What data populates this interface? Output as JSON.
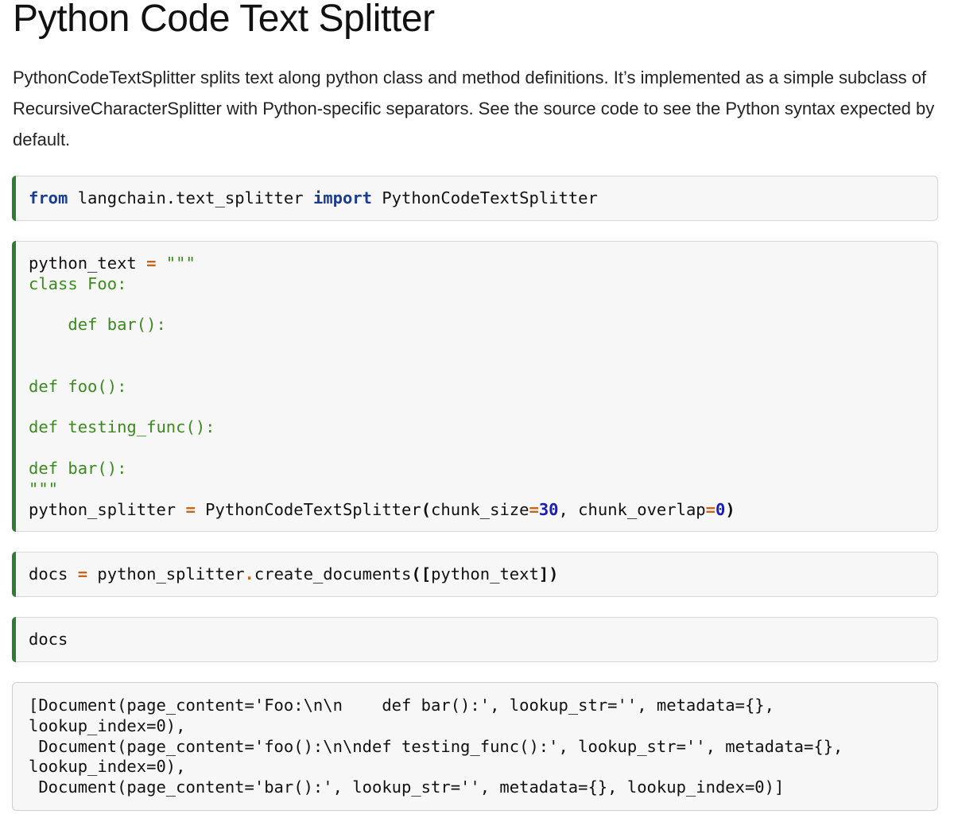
{
  "page": {
    "title": "Python Code Text Splitter",
    "intro": "PythonCodeTextSplitter splits text along python class and method definitions. It’s implemented as a simple subclass of RecursiveCharacterSplitter with Python-specific separators. See the source code to see the Python syntax expected by default."
  },
  "colors": {
    "cell_indicator": "#2e7d32",
    "cell_background": "#f7f7f7",
    "keyword": "#1a3d8f",
    "string": "#3b8a1e",
    "operator": "#c7641b",
    "number": "#1c1cb0"
  },
  "cells": {
    "import": {
      "kw_from": "from",
      "module": " langchain.text_splitter ",
      "kw_import": "import",
      "name": " PythonCodeTextSplitter"
    },
    "definition": {
      "var": "python_text ",
      "eq": "=",
      "string": " \"\"\"\nclass Foo:\n\n    def bar():\n\n\ndef foo():\n\ndef testing_func():\n\ndef bar():\n\"\"\"",
      "var2": "\npython_splitter ",
      "eq2": "=",
      "call": " PythonCodeTextSplitter",
      "open": "(",
      "arg1": "chunk_size",
      "eq3": "=",
      "num1": "30",
      "sep": ", chunk_overlap",
      "eq4": "=",
      "num2": "0",
      "close": ")"
    },
    "create": {
      "var": "docs ",
      "eq": "=",
      "obj": " python_splitter",
      "dot": ".",
      "method": "create_documents",
      "open": "([",
      "arg": "python_text",
      "close": "])"
    },
    "docs": {
      "code": "docs"
    },
    "output": {
      "text": "[Document(page_content='Foo:\\n\\n    def bar():', lookup_str='', metadata={},\nlookup_index=0),\n Document(page_content='foo():\\n\\ndef testing_func():', lookup_str='', metadata={},\nlookup_index=0),\n Document(page_content='bar():', lookup_str='', metadata={}, lookup_index=0)]"
    }
  }
}
